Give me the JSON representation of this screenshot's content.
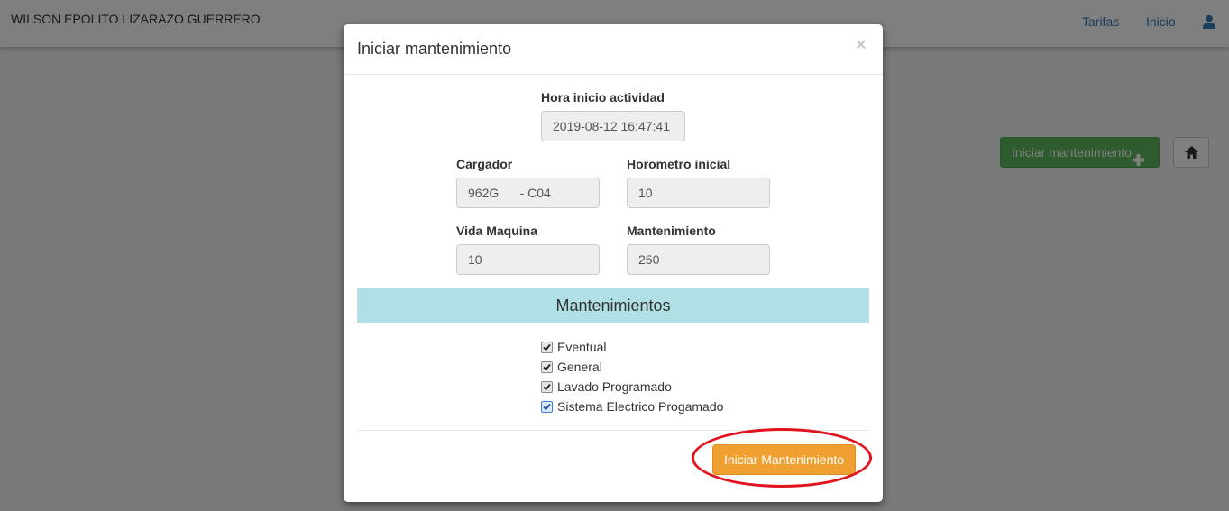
{
  "navbar": {
    "brand": "WILSON EPOLITO LIZARAZO GUERRERO",
    "links": [
      {
        "label": "Tarifas"
      },
      {
        "label": "Inicio"
      }
    ],
    "user_icon": "user-icon"
  },
  "page": {
    "start_button_label": "Iniciar mantenimiento",
    "start_button_icon": "plus-icon",
    "home_button_icon": "home-icon"
  },
  "modal": {
    "title": "Iniciar mantenimiento",
    "close_symbol": "×",
    "start_time": {
      "label": "Hora inicio actividad",
      "value": "2019-08-12 16:47:41"
    },
    "loader": {
      "label": "Cargador",
      "value": "962G      - C04"
    },
    "hour_meter": {
      "label": "Horometro inicial",
      "value": "10"
    },
    "machine_life": {
      "label": "Vida Maquina",
      "value": "10"
    },
    "maintenance": {
      "label": "Mantenimiento",
      "value": "250"
    },
    "section_title": "Mantenimientos",
    "checks": [
      {
        "label": "Eventual",
        "checked": true
      },
      {
        "label": "General",
        "checked": true
      },
      {
        "label": "Lavado Programado",
        "checked": true
      },
      {
        "label": "Sistema Electrico Progamado",
        "checked": true
      }
    ],
    "submit_label": "Iniciar Mantenimiento"
  },
  "colors": {
    "section_bg": "#b0e0e6",
    "submit_bg": "#f0a030",
    "green_button": "#5cb85c",
    "annotation": "#e0141e"
  }
}
